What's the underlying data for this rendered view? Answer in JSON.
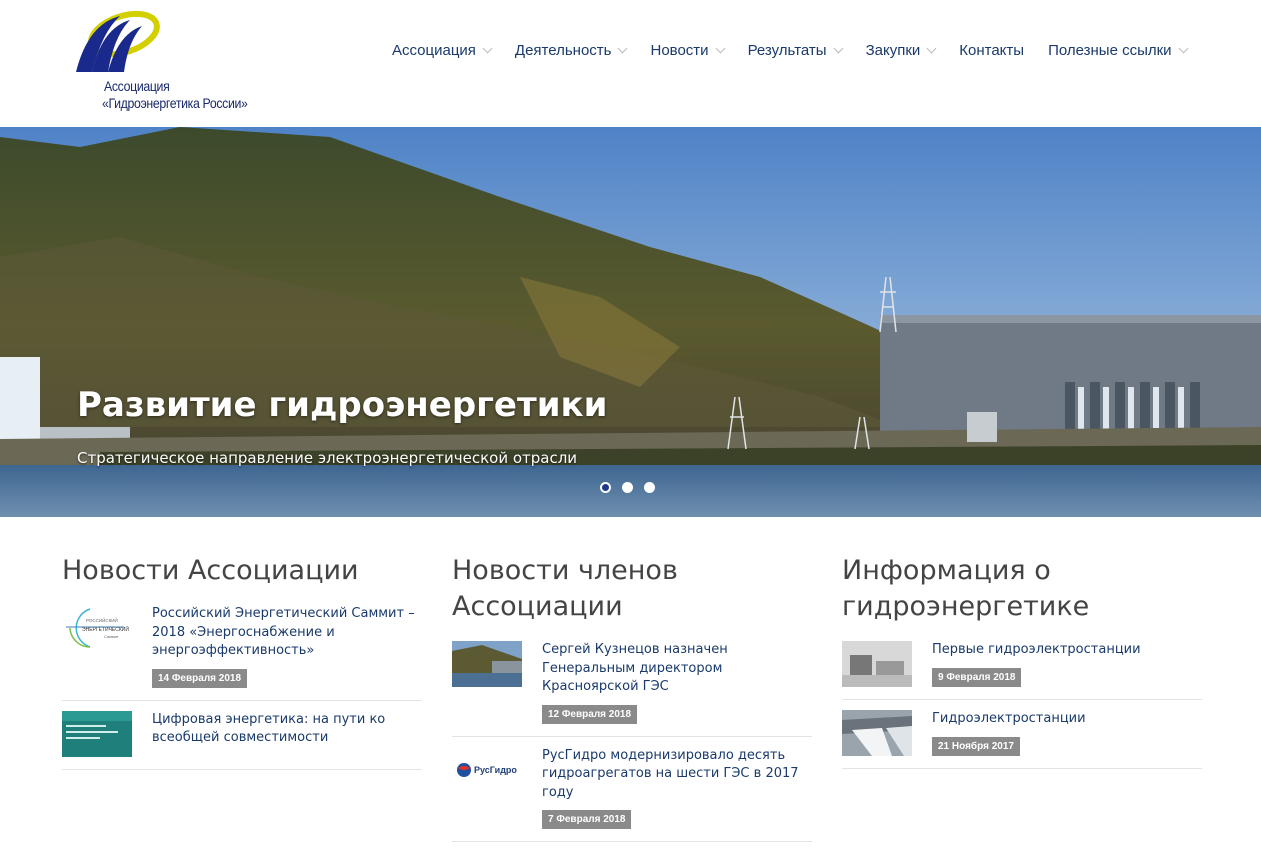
{
  "logo": {
    "line1": "Ассоциация",
    "line2": "«Гидроэнергетика России»"
  },
  "nav": [
    {
      "label": "Ассоциация",
      "dropdown": true
    },
    {
      "label": "Деятельность",
      "dropdown": true
    },
    {
      "label": "Новости",
      "dropdown": true
    },
    {
      "label": "Результаты",
      "dropdown": true
    },
    {
      "label": "Закупки",
      "dropdown": true
    },
    {
      "label": "Контакты",
      "dropdown": false
    },
    {
      "label": "Полезные ссылки",
      "dropdown": true
    }
  ],
  "hero": {
    "title": "Развитие гидроэнергетики",
    "subtitle": "Стратегическое направление электроэнергетической отрасли",
    "slides": 3,
    "active_slide": 1
  },
  "columns": [
    {
      "title": "Новости Ассоциации",
      "items": [
        {
          "title": "Российский Энергетический Саммит – 2018 «Энергоснабжение и энергоэффективность»",
          "date": "14 Февраля 2018",
          "thumb": "summit-logo"
        },
        {
          "title": "Цифровая энергетика: на пути ко всеобщей совместимости",
          "date": "",
          "thumb": "conference-banner"
        }
      ]
    },
    {
      "title": "Новости членов Ассоциации",
      "items": [
        {
          "title": "Сергей Кузнецов назначен Генеральным директором Красноярской ГЭС",
          "date": "12 Февраля 2018",
          "thumb": "dam-photo"
        },
        {
          "title": "РусГидро модернизировало десять гидроагрегатов на шести ГЭС в 2017 году",
          "date": "7 Февраля 2018",
          "thumb": "rushydro-logo"
        }
      ]
    },
    {
      "title": "Информация о гидроэнергетике",
      "items": [
        {
          "title": "Первые гидроэлектростанции",
          "date": "9 Февраля 2018",
          "thumb": "historic-photo"
        },
        {
          "title": "Гидроэлектростанции",
          "date": "21 Ноября 2017",
          "thumb": "spillway-photo"
        }
      ]
    }
  ],
  "thumb_text": {
    "summit_1": "РОССИЙСКИЙ",
    "summit_2": "ЭНЕРГЕТИЧЕСКИЙ",
    "summit_3": "Саммит",
    "rushydro": "РусГидро"
  },
  "colors": {
    "nav_text": "#1a3a6b",
    "badge": "#8a8a8a",
    "dot_active": "#1b3a8c",
    "logo_blue": "#1a2a6c",
    "logo_yellow": "#d4d000"
  }
}
